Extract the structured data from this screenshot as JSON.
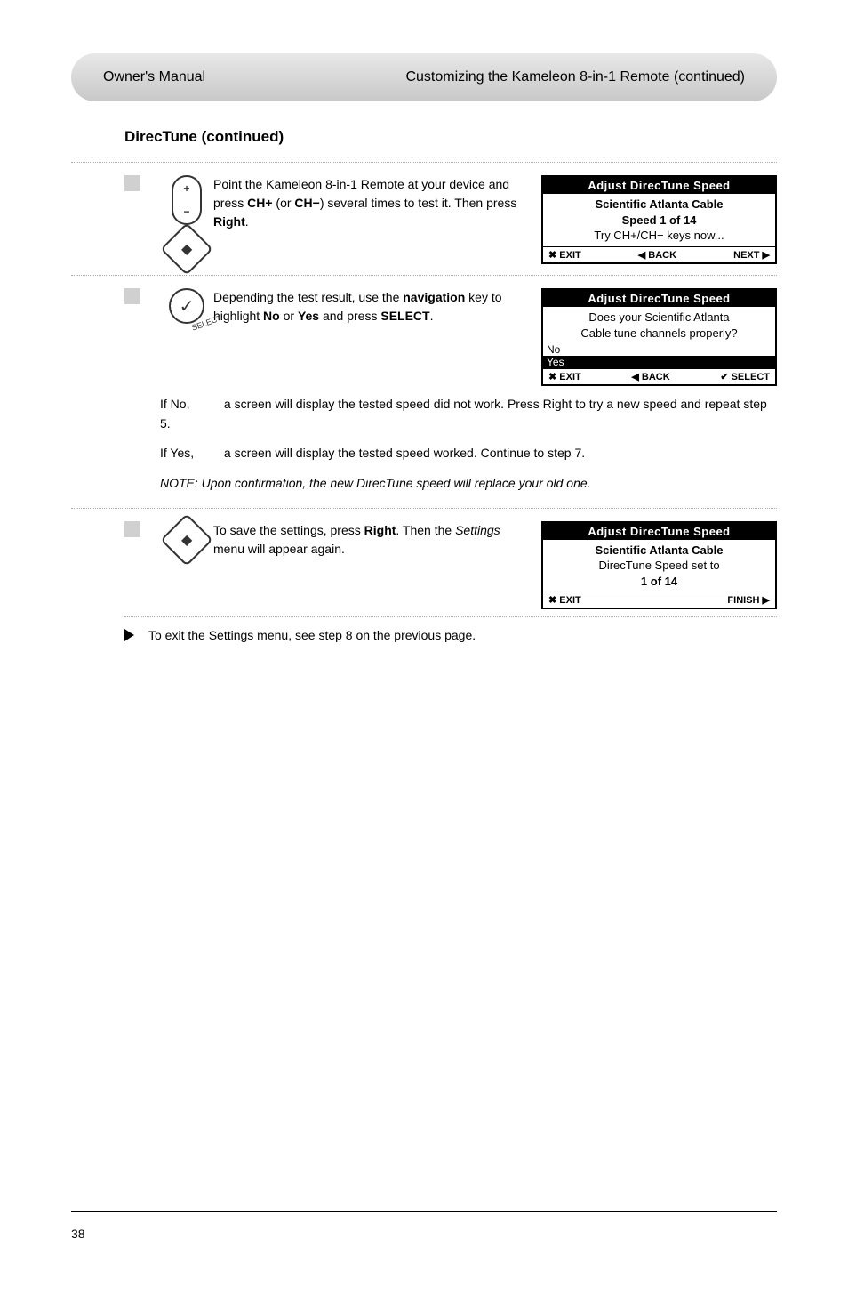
{
  "header": {
    "left": "Owner's Manual",
    "right": "Customizing the Kameleon 8-in-1 Remote (continued)"
  },
  "sectionTitle": "DirecTune (continued)",
  "steps": {
    "s5": {
      "text_1": "Point the Kameleon 8-in-1 Remote at your device and press ",
      "b1": "CH+",
      "text_2": " (or ",
      "b2": "CH−",
      "text_3": ") several times to test it. Then press ",
      "b3": "Right",
      "text_4": "."
    },
    "s6": {
      "text_1": "Depending the test result, use the ",
      "b1": "navigation",
      "text_2": " key to highlight ",
      "b2": "No",
      "text_3": " or ",
      "b3": "Yes",
      "text_4": " and press ",
      "b4": "SELECT",
      "text_5": "."
    },
    "afterS6": {
      "noLabel": "If No,",
      "noText": "a screen will display the tested speed did not work. Press Right to try a new speed and repeat step 5.",
      "yesLabel": "If Yes,",
      "yesText": "a screen will display the tested speed worked. Continue to step 7.",
      "note": "NOTE: Upon confirmation, the new DirecTune speed will replace your old one."
    },
    "s7": {
      "text_1": "To save the settings, press ",
      "b1": "Right",
      "text_2": ". Then the ",
      "i1": "Settings",
      "text_3": " menu will appear again."
    }
  },
  "lcd": {
    "title": "Adjust DirecTune Speed",
    "screen5": {
      "line1": "Scientific Atlanta Cable",
      "line2": "Speed 1 of 14",
      "line3": "Try CH+/CH− keys now...",
      "f1": "✖ EXIT",
      "f2": "◀ BACK",
      "f3": "NEXT ▶"
    },
    "screen6": {
      "line1": "Does your Scientific Atlanta",
      "line2": "Cable tune channels properly?",
      "optNo": "No",
      "optYes": "Yes",
      "f1": "✖ EXIT",
      "f2": "◀ BACK",
      "f3": "✔ SELECT"
    },
    "screen7": {
      "line1": "Scientific Atlanta Cable",
      "line2": "DirecTune Speed set to",
      "line3": "1 of 14",
      "f1": "✖ EXIT",
      "f3": "FINISH ▶"
    }
  },
  "finalLine": "To exit the Settings menu, see step 8 on the previous page.",
  "pageNumber": "38",
  "iconLabel": "SELECT"
}
